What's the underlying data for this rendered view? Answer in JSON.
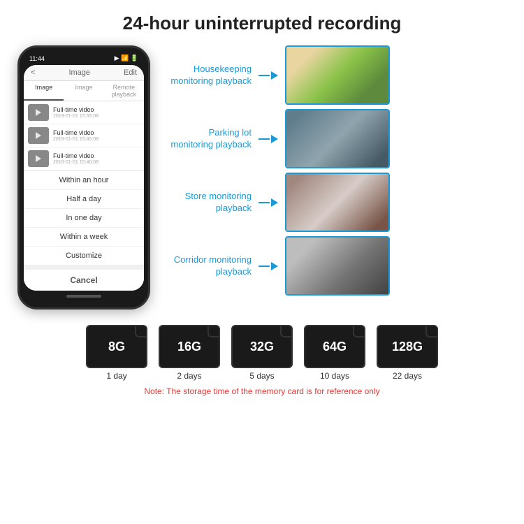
{
  "title": "24-hour uninterrupted recording",
  "phone": {
    "time": "11:44",
    "header_title": "Image",
    "header_edit": "Edit",
    "header_back": "<",
    "tabs": [
      "Image",
      "Image",
      "Remote playback"
    ],
    "videos": [
      {
        "title": "Full-time video",
        "date": "2019-01-01 15:55:08"
      },
      {
        "title": "Full-time video",
        "date": "2019-01-01 15:45:08"
      },
      {
        "title": "Full-time video",
        "date": "2019-01-01 15:40:08"
      }
    ],
    "dropdown_items": [
      "Within an hour",
      "Half a day",
      "In one day",
      "Within a week",
      "Customize"
    ],
    "cancel": "Cancel"
  },
  "monitoring": [
    {
      "label": "Housekeeping\nmonitoring playback",
      "img_class": "img-housekeeping"
    },
    {
      "label": "Parking lot\nmonitoring playback",
      "img_class": "img-parking"
    },
    {
      "label": "Store monitoring\nplayback",
      "img_class": "img-store"
    },
    {
      "label": "Corridor monitoring\nplayback",
      "img_class": "img-corridor"
    }
  ],
  "sdcards": [
    {
      "capacity": "8G",
      "days": "1 day"
    },
    {
      "capacity": "16G",
      "days": "2 days"
    },
    {
      "capacity": "32G",
      "days": "5 days"
    },
    {
      "capacity": "64G",
      "days": "10 days"
    },
    {
      "capacity": "128G",
      "days": "22 days"
    }
  ],
  "note": "Note: The storage time of the memory card is for reference only"
}
